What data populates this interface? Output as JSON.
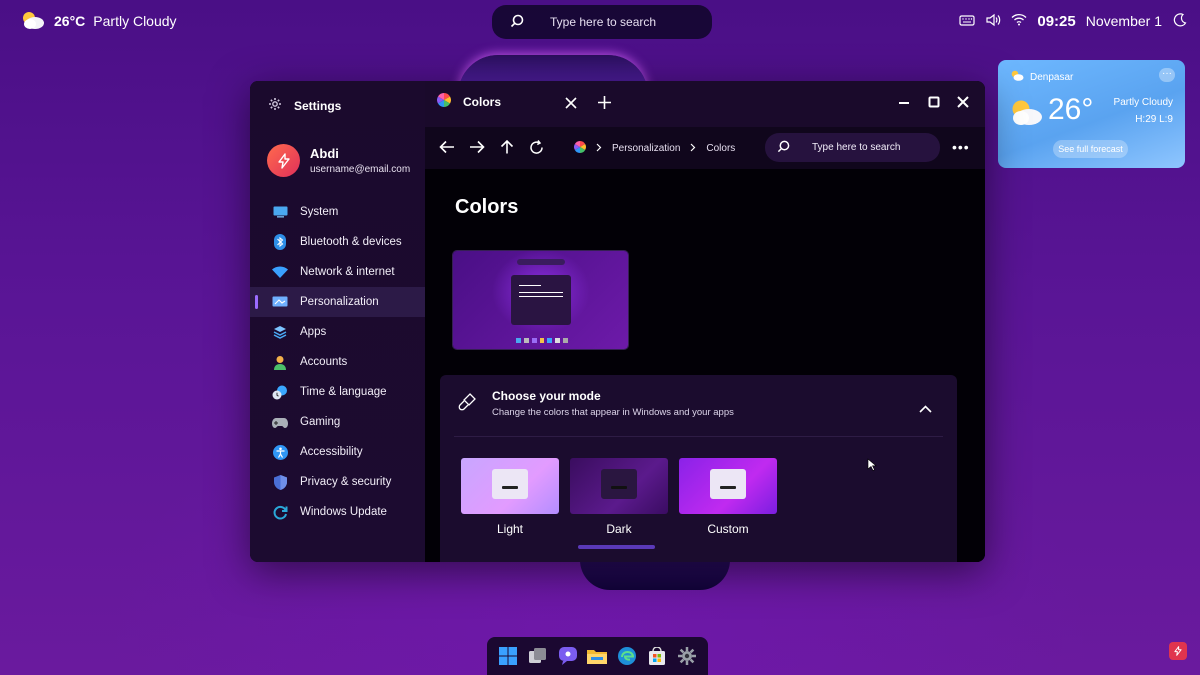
{
  "topbar": {
    "weather": {
      "temp": "26°C",
      "condition": "Partly Cloudy",
      "icon": "partly-cloudy-icon"
    },
    "search": {
      "placeholder": "Type here to search"
    },
    "tray": {
      "time": "09:25",
      "date": "November 1"
    }
  },
  "widget": {
    "location": "Denpasar",
    "temp": "26°",
    "condition": "Partly Cloudy",
    "high_low": "H:29 L:9",
    "forecast_button": "See full forecast",
    "more": "···"
  },
  "window": {
    "app_title": "Settings",
    "user": {
      "name": "Abdi",
      "email": "username@email.com"
    },
    "sidebar": {
      "items": [
        {
          "label": "System",
          "icon": "system-display-icon",
          "color": "#4aa8f0"
        },
        {
          "label": "Bluetooth & devices",
          "icon": "bluetooth-icon",
          "color": "#2e8fe8"
        },
        {
          "label": "Network & internet",
          "icon": "wifi-icon",
          "color": "#3aa0ff"
        },
        {
          "label": "Personalization",
          "icon": "paint-brush-icon",
          "color": "#6fb0ff",
          "active": true
        },
        {
          "label": "Apps",
          "icon": "apps-stack-icon",
          "color": "#49a9f5"
        },
        {
          "label": "Accounts",
          "icon": "accounts-person-icon",
          "color": "#4bc06a"
        },
        {
          "label": "Time & language",
          "icon": "globe-clock-icon",
          "color": "#3aa7ff"
        },
        {
          "label": "Gaming",
          "icon": "gamepad-icon",
          "color": "#aab0b8"
        },
        {
          "label": "Accessibility",
          "icon": "accessibility-icon",
          "color": "#2f96f5"
        },
        {
          "label": "Privacy & security",
          "icon": "shield-icon",
          "color": "#4a6fd6"
        },
        {
          "label": "Windows Update",
          "icon": "update-refresh-icon",
          "color": "#2aa7d8"
        }
      ]
    },
    "tab": {
      "label": "Colors"
    },
    "breadcrumb": {
      "parent": "Personalization",
      "current": "Colors"
    },
    "nav_search": {
      "placeholder": "Type here to search"
    },
    "page_title": "Colors",
    "mode": {
      "title": "Choose your mode",
      "description": "Change the colors that appear in Windows and your apps",
      "options": [
        {
          "label": "Light"
        },
        {
          "label": "Dark",
          "selected": true
        },
        {
          "label": "Custom"
        }
      ]
    }
  },
  "taskbar": {
    "icons": [
      "windows-start-icon",
      "task-view-icon",
      "chat-icon",
      "file-explorer-icon",
      "edge-browser-icon",
      "store-icon",
      "settings-gear-icon"
    ]
  },
  "colors": {
    "accent": "#9b6cff",
    "sidebar_bg": "#1b0a2d",
    "card_bg": "#1b0c2e"
  }
}
